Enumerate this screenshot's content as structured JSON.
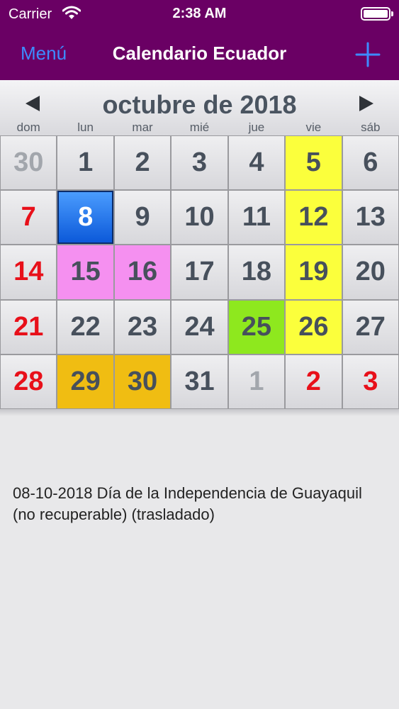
{
  "status": {
    "carrier": "Carrier",
    "time": "2:38 AM"
  },
  "nav": {
    "menu_label": "Menú",
    "title": "Calendario Ecuador"
  },
  "calendar": {
    "month_title": "octubre de 2018",
    "weekdays": [
      "dom",
      "lun",
      "mar",
      "mié",
      "jue",
      "vie",
      "sáb"
    ],
    "weeks": [
      [
        {
          "d": "30",
          "s": "muted"
        },
        {
          "d": "1"
        },
        {
          "d": "2"
        },
        {
          "d": "3"
        },
        {
          "d": "4"
        },
        {
          "d": "5",
          "bg": "#fbff3c"
        },
        {
          "d": "6"
        }
      ],
      [
        {
          "d": "7",
          "s": "red"
        },
        {
          "d": "8",
          "s": "today"
        },
        {
          "d": "9"
        },
        {
          "d": "10"
        },
        {
          "d": "11"
        },
        {
          "d": "12",
          "bg": "#fbff3c"
        },
        {
          "d": "13"
        }
      ],
      [
        {
          "d": "14",
          "s": "red"
        },
        {
          "d": "15",
          "bg": "#f590f0"
        },
        {
          "d": "16",
          "bg": "#f590f0"
        },
        {
          "d": "17"
        },
        {
          "d": "18"
        },
        {
          "d": "19",
          "bg": "#fbff3c"
        },
        {
          "d": "20"
        }
      ],
      [
        {
          "d": "21",
          "s": "red"
        },
        {
          "d": "22"
        },
        {
          "d": "23"
        },
        {
          "d": "24"
        },
        {
          "d": "25",
          "bg": "#8ee81e"
        },
        {
          "d": "26",
          "bg": "#fbff3c"
        },
        {
          "d": "27"
        }
      ],
      [
        {
          "d": "28",
          "s": "red"
        },
        {
          "d": "29",
          "bg": "#f0bd12"
        },
        {
          "d": "30",
          "bg": "#f0bd12"
        },
        {
          "d": "31"
        },
        {
          "d": "1",
          "s": "muted"
        },
        {
          "d": "2",
          "s": "red"
        },
        {
          "d": "3",
          "s": "red"
        }
      ]
    ]
  },
  "holiday_note": "08-10-2018 Día de la Independencia de Guayaquil (no recuperable) (trasladado)",
  "colors": {
    "nav_bg": "#6a0064",
    "accent": "#3d8bff",
    "weekend_red": "#e8101a"
  }
}
